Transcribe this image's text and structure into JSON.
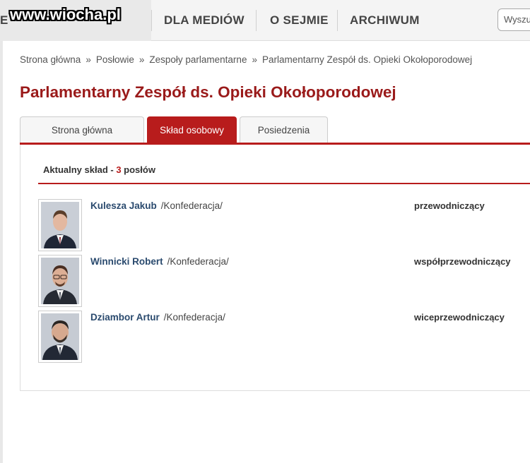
{
  "nav": {
    "items": [
      "E",
      "DLA MEDIÓW",
      "O SEJMIE",
      "ARCHIWUM"
    ],
    "search_placeholder": "Wyszu"
  },
  "watermark": "www.wiocha.pl",
  "breadcrumb": [
    "Strona główna",
    "Posłowie",
    "Zespoły parlamentarne",
    "Parlamentarny Zespół ds. Opieki Okołoporodowej"
  ],
  "breadcrumb_separator": "»",
  "title": "Parlamentarny Zespół ds. Opieki Okołoporodowej",
  "tabs": [
    "Strona główna",
    "Skład osobowy",
    "Posiedzenia"
  ],
  "active_tab": "Skład osobowy",
  "composition": {
    "prefix": "Aktualny skład - ",
    "count": "3",
    "suffix": " posłów"
  },
  "members": [
    {
      "name": "Kulesza Jakub",
      "party": "/Konfederacja/",
      "role": "przewodniczący"
    },
    {
      "name": "Winnicki Robert",
      "party": "/Konfederacja/",
      "role": "współprzewodniczący"
    },
    {
      "name": "Dziambor Artur",
      "party": "/Konfederacja/",
      "role": "wiceprzewodniczący"
    }
  ],
  "colors": {
    "accent": "#b81c1c",
    "title": "#9a1a1a",
    "link": "#2a4a6e"
  }
}
